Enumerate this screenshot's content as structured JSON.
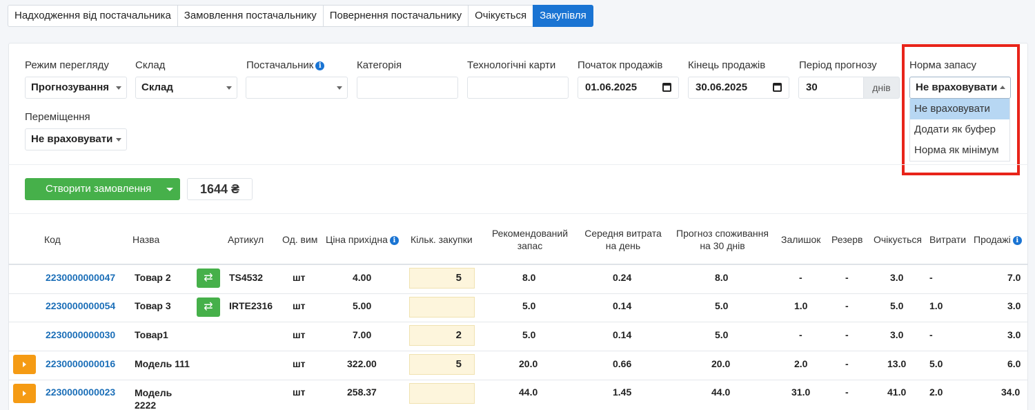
{
  "tabs": [
    "Надходження від постачальника",
    "Замовлення постачальнику",
    "Повернення постачальнику",
    "Очікується",
    "Закупівля"
  ],
  "filters": {
    "view_mode": {
      "label": "Режим перегляду",
      "value": "Прогнозування"
    },
    "warehouse": {
      "label": "Склад",
      "value": "Склад"
    },
    "supplier": {
      "label": "Постачальник",
      "value": ""
    },
    "category": {
      "label": "Категорія",
      "value": ""
    },
    "tech_cards": {
      "label": "Технологічні карти",
      "value": ""
    },
    "sales_start": {
      "label": "Початок продажів",
      "value": "01.06.2025"
    },
    "sales_end": {
      "label": "Кінець продажів",
      "value": "30.06.2025"
    },
    "forecast_period": {
      "label": "Період прогнозу",
      "value": "30",
      "unit": "днів"
    },
    "stock_norm": {
      "label": "Норма запасу",
      "value": "Не враховувати",
      "options": [
        "Не враховувати",
        "Додати як буфер",
        "Норма як мінімум"
      ]
    },
    "movement": {
      "label": "Переміщення",
      "value": "Не враховувати"
    }
  },
  "actions": {
    "create_order": "Створити замовлення",
    "total": "1644 ₴"
  },
  "table": {
    "headers": {
      "code": "Код",
      "name": "Назва",
      "article": "Артикул",
      "unit": "Од. вим",
      "price": "Ціна прихідна",
      "qty": "Кільк. закупки",
      "rec_stock": "Рекомендований запас",
      "avg_use": "Середня витрата на день",
      "forecast": "Прогноз споживання на 30 днів",
      "balance": "Залишок",
      "reserve": "Резерв",
      "expected": "Очікується",
      "costs": "Витрати",
      "sales": "Продажі"
    },
    "rows": [
      {
        "code": "2230000000047",
        "name": "Товар 2",
        "article": "TS4532",
        "unit": "шт",
        "price": "4.00",
        "qty": "5",
        "rec_stock": "8.0",
        "avg_use": "0.24",
        "forecast": "8.0",
        "balance": "-",
        "reserve": "-",
        "expected": "3.0",
        "costs": "-",
        "sales": "7.0"
      },
      {
        "code": "2230000000054",
        "name": "Товар 3",
        "article": "IRTE2316",
        "unit": "шт",
        "price": "5.00",
        "qty": "",
        "rec_stock": "5.0",
        "avg_use": "0.14",
        "forecast": "5.0",
        "balance": "1.0",
        "reserve": "-",
        "expected": "5.0",
        "costs": "1.0",
        "sales": "3.0"
      },
      {
        "code": "2230000000030",
        "name": "Товар1",
        "article": "",
        "unit": "шт",
        "price": "7.00",
        "qty": "2",
        "rec_stock": "5.0",
        "avg_use": "0.14",
        "forecast": "5.0",
        "balance": "-",
        "reserve": "-",
        "expected": "3.0",
        "costs": "-",
        "sales": "3.0"
      },
      {
        "code": "2230000000016",
        "name": "Модель 111",
        "article": "",
        "unit": "шт",
        "price": "322.00",
        "qty": "5",
        "rec_stock": "20.0",
        "avg_use": "0.66",
        "forecast": "20.0",
        "balance": "2.0",
        "reserve": "-",
        "expected": "13.0",
        "costs": "5.0",
        "sales": "6.0"
      },
      {
        "code": "2230000000023",
        "name": "Модель 2222",
        "article": "",
        "unit": "шт",
        "price": "258.37",
        "qty": "",
        "rec_stock": "44.0",
        "avg_use": "1.45",
        "forecast": "44.0",
        "balance": "31.0",
        "reserve": "-",
        "expected": "41.0",
        "costs": "2.0",
        "sales": "34.0"
      }
    ]
  }
}
